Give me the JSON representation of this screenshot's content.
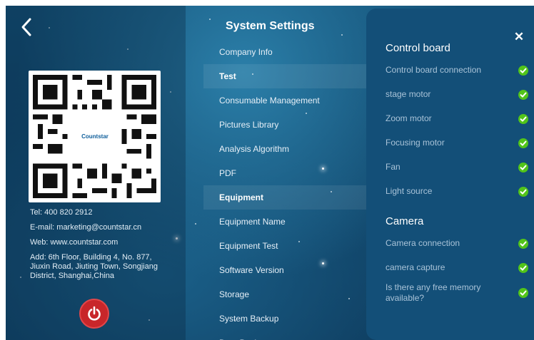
{
  "header": {
    "back_icon": "chevron-left-icon",
    "title": "System Settings"
  },
  "left": {
    "qr_logo_text": "Countstar",
    "contact": {
      "tel": "Tel: 400 820 2912",
      "email": "E-mail: marketing@countstar.cn",
      "web": "Web: www.countstar.com",
      "address": "Add: 6th Floor, Building 4, No. 877, Jiuxin Road, Jiuting Town, Songjiang District, Shanghai,China"
    },
    "power_icon": "power-icon",
    "power_color": "#c8262a"
  },
  "menu": [
    {
      "label": "Company Info",
      "group": false
    },
    {
      "label": "Test",
      "group": true
    },
    {
      "label": "Consumable Management",
      "group": false
    },
    {
      "label": "Pictures Library",
      "group": false
    },
    {
      "label": "Analysis Algorithm",
      "group": false
    },
    {
      "label": "PDF",
      "group": false
    },
    {
      "label": "Equipment",
      "group": true
    },
    {
      "label": "Equipment Name",
      "group": false
    },
    {
      "label": "Equipment Test",
      "group": false
    },
    {
      "label": "Software Version",
      "group": false
    },
    {
      "label": "Storage",
      "group": false
    },
    {
      "label": "System Backup",
      "group": false
    },
    {
      "label": "Data Backup",
      "group": false
    }
  ],
  "panel": {
    "close_icon": "close-icon",
    "control_board": {
      "title": "Control board",
      "items": [
        "Control board connection",
        "stage motor",
        "Zoom motor",
        "Focusing motor",
        "Fan",
        "Light source"
      ]
    },
    "camera": {
      "title": "Camera",
      "items": [
        "Camera connection",
        "camera capture",
        "Is there any free memory available?"
      ]
    },
    "status_icon": "check-circle-icon",
    "status_color": "#52c41a"
  }
}
